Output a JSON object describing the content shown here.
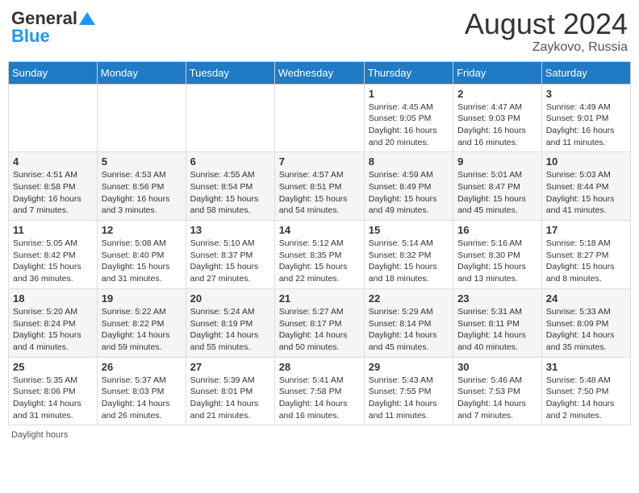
{
  "header": {
    "logo_general": "General",
    "logo_blue": "Blue",
    "month_year": "August 2024",
    "location": "Zaykovo, Russia"
  },
  "footer": {
    "daylight_label": "Daylight hours"
  },
  "calendar": {
    "days_of_week": [
      "Sunday",
      "Monday",
      "Tuesday",
      "Wednesday",
      "Thursday",
      "Friday",
      "Saturday"
    ],
    "weeks": [
      [
        {
          "day": "",
          "info": ""
        },
        {
          "day": "",
          "info": ""
        },
        {
          "day": "",
          "info": ""
        },
        {
          "day": "",
          "info": ""
        },
        {
          "day": "1",
          "info": "Sunrise: 4:45 AM\nSunset: 9:05 PM\nDaylight: 16 hours and 20 minutes."
        },
        {
          "day": "2",
          "info": "Sunrise: 4:47 AM\nSunset: 9:03 PM\nDaylight: 16 hours and 16 minutes."
        },
        {
          "day": "3",
          "info": "Sunrise: 4:49 AM\nSunset: 9:01 PM\nDaylight: 16 hours and 11 minutes."
        }
      ],
      [
        {
          "day": "4",
          "info": "Sunrise: 4:51 AM\nSunset: 8:58 PM\nDaylight: 16 hours and 7 minutes."
        },
        {
          "day": "5",
          "info": "Sunrise: 4:53 AM\nSunset: 8:56 PM\nDaylight: 16 hours and 3 minutes."
        },
        {
          "day": "6",
          "info": "Sunrise: 4:55 AM\nSunset: 8:54 PM\nDaylight: 15 hours and 58 minutes."
        },
        {
          "day": "7",
          "info": "Sunrise: 4:57 AM\nSunset: 8:51 PM\nDaylight: 15 hours and 54 minutes."
        },
        {
          "day": "8",
          "info": "Sunrise: 4:59 AM\nSunset: 8:49 PM\nDaylight: 15 hours and 49 minutes."
        },
        {
          "day": "9",
          "info": "Sunrise: 5:01 AM\nSunset: 8:47 PM\nDaylight: 15 hours and 45 minutes."
        },
        {
          "day": "10",
          "info": "Sunrise: 5:03 AM\nSunset: 8:44 PM\nDaylight: 15 hours and 41 minutes."
        }
      ],
      [
        {
          "day": "11",
          "info": "Sunrise: 5:05 AM\nSunset: 8:42 PM\nDaylight: 15 hours and 36 minutes."
        },
        {
          "day": "12",
          "info": "Sunrise: 5:08 AM\nSunset: 8:40 PM\nDaylight: 15 hours and 31 minutes."
        },
        {
          "day": "13",
          "info": "Sunrise: 5:10 AM\nSunset: 8:37 PM\nDaylight: 15 hours and 27 minutes."
        },
        {
          "day": "14",
          "info": "Sunrise: 5:12 AM\nSunset: 8:35 PM\nDaylight: 15 hours and 22 minutes."
        },
        {
          "day": "15",
          "info": "Sunrise: 5:14 AM\nSunset: 8:32 PM\nDaylight: 15 hours and 18 minutes."
        },
        {
          "day": "16",
          "info": "Sunrise: 5:16 AM\nSunset: 8:30 PM\nDaylight: 15 hours and 13 minutes."
        },
        {
          "day": "17",
          "info": "Sunrise: 5:18 AM\nSunset: 8:27 PM\nDaylight: 15 hours and 8 minutes."
        }
      ],
      [
        {
          "day": "18",
          "info": "Sunrise: 5:20 AM\nSunset: 8:24 PM\nDaylight: 15 hours and 4 minutes."
        },
        {
          "day": "19",
          "info": "Sunrise: 5:22 AM\nSunset: 8:22 PM\nDaylight: 14 hours and 59 minutes."
        },
        {
          "day": "20",
          "info": "Sunrise: 5:24 AM\nSunset: 8:19 PM\nDaylight: 14 hours and 55 minutes."
        },
        {
          "day": "21",
          "info": "Sunrise: 5:27 AM\nSunset: 8:17 PM\nDaylight: 14 hours and 50 minutes."
        },
        {
          "day": "22",
          "info": "Sunrise: 5:29 AM\nSunset: 8:14 PM\nDaylight: 14 hours and 45 minutes."
        },
        {
          "day": "23",
          "info": "Sunrise: 5:31 AM\nSunset: 8:11 PM\nDaylight: 14 hours and 40 minutes."
        },
        {
          "day": "24",
          "info": "Sunrise: 5:33 AM\nSunset: 8:09 PM\nDaylight: 14 hours and 35 minutes."
        }
      ],
      [
        {
          "day": "25",
          "info": "Sunrise: 5:35 AM\nSunset: 8:06 PM\nDaylight: 14 hours and 31 minutes."
        },
        {
          "day": "26",
          "info": "Sunrise: 5:37 AM\nSunset: 8:03 PM\nDaylight: 14 hours and 26 minutes."
        },
        {
          "day": "27",
          "info": "Sunrise: 5:39 AM\nSunset: 8:01 PM\nDaylight: 14 hours and 21 minutes."
        },
        {
          "day": "28",
          "info": "Sunrise: 5:41 AM\nSunset: 7:58 PM\nDaylight: 14 hours and 16 minutes."
        },
        {
          "day": "29",
          "info": "Sunrise: 5:43 AM\nSunset: 7:55 PM\nDaylight: 14 hours and 11 minutes."
        },
        {
          "day": "30",
          "info": "Sunrise: 5:46 AM\nSunset: 7:53 PM\nDaylight: 14 hours and 7 minutes."
        },
        {
          "day": "31",
          "info": "Sunrise: 5:48 AM\nSunset: 7:50 PM\nDaylight: 14 hours and 2 minutes."
        }
      ]
    ]
  }
}
